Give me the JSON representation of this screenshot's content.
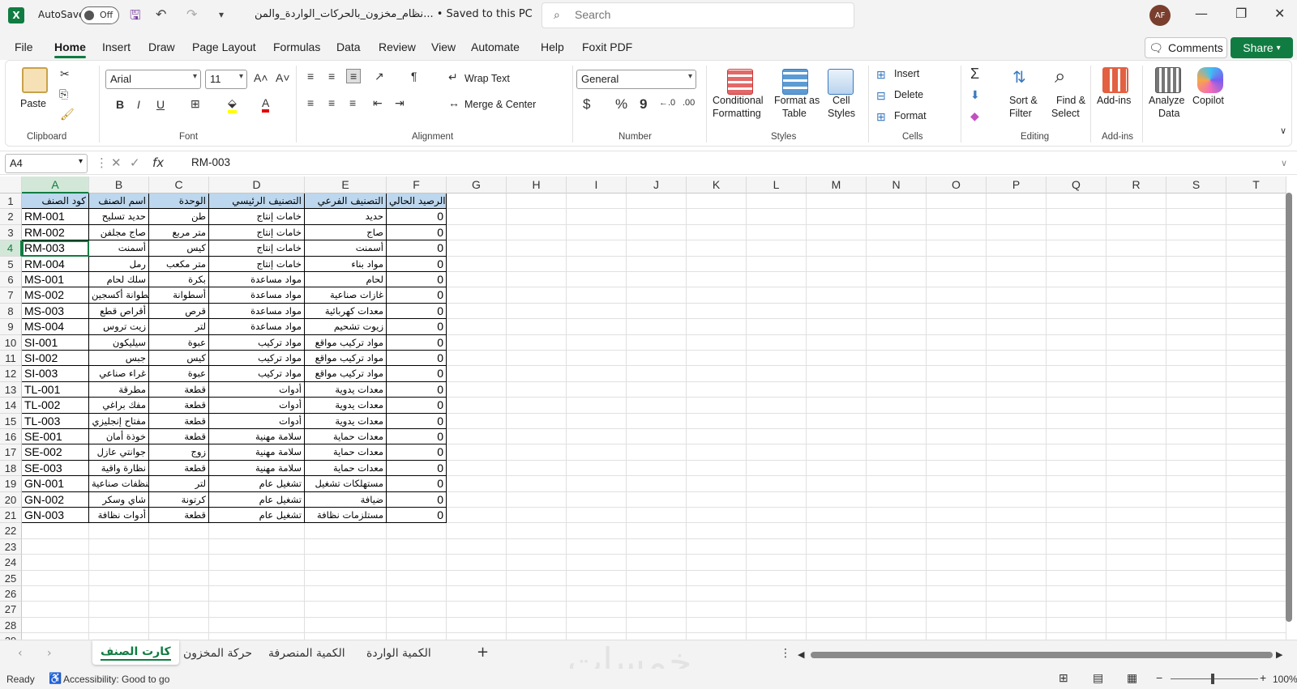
{
  "titlebar": {
    "app_logo": "X",
    "autosave_label": "AutoSave",
    "autosave_state": "Off",
    "doc_title": "نظام_مخزون_بالحركات_الواردة_والمن... • Saved to this PC",
    "search_placeholder": "Search",
    "avatar_initials": "AF"
  },
  "menu": {
    "tabs": [
      "File",
      "Home",
      "Insert",
      "Draw",
      "Page Layout",
      "Formulas",
      "Data",
      "Review",
      "View",
      "Automate",
      "Help",
      "Foxit PDF"
    ],
    "active_tab": "Home",
    "comments_label": "Comments",
    "share_label": "Share"
  },
  "ribbon": {
    "clipboard": {
      "paste": "Paste",
      "group": "Clipboard"
    },
    "font": {
      "name": "Arial",
      "size": "11",
      "group": "Font",
      "bold": "B",
      "italic": "I",
      "underline": "U",
      "grow": "A^",
      "shrink": "Aˇ"
    },
    "alignment": {
      "wrap": "Wrap Text",
      "merge": "Merge & Center",
      "group": "Alignment"
    },
    "number": {
      "format": "General",
      "currency": "$",
      "percent": "%",
      "comma": "9",
      "group": "Number"
    },
    "styles": {
      "conditional": "Conditional",
      "conditional2": "Formatting",
      "format_table": "Format as",
      "format_table2": "Table",
      "cell_styles": "Cell",
      "cell_styles2": "Styles",
      "group": "Styles"
    },
    "cells": {
      "insert": "Insert",
      "delete": "Delete",
      "format": "Format",
      "group": "Cells"
    },
    "editing": {
      "sort": "Sort &",
      "sort2": "Filter",
      "find": "Find &",
      "find2": "Select",
      "group": "Editing"
    },
    "addins": {
      "label": "Add-ins",
      "group": "Add-ins"
    },
    "analyze": {
      "label": "Analyze",
      "label2": "Data"
    },
    "copilot": {
      "label": "Copilot"
    }
  },
  "formula_bar": {
    "name_box": "A4",
    "formula": "RM-003",
    "fx": "fx"
  },
  "columns": [
    "A",
    "B",
    "C",
    "D",
    "E",
    "F",
    "G",
    "H",
    "I",
    "J",
    "K",
    "L",
    "M",
    "N",
    "O",
    "P",
    "Q",
    "R",
    "S",
    "T"
  ],
  "rows": [
    "1",
    "2",
    "3",
    "4",
    "5",
    "6",
    "7",
    "8",
    "9",
    "10",
    "11",
    "12",
    "13",
    "14",
    "15",
    "16",
    "17",
    "18",
    "19",
    "20",
    "21",
    "22",
    "23",
    "24",
    "25",
    "26",
    "27",
    "28",
    "29"
  ],
  "table": {
    "headers": [
      "كود الصنف",
      "اسم الصنف",
      "الوحدة",
      "التصنيف الرئيسي",
      "التصنيف الفرعي",
      "الرصيد الحالي"
    ],
    "rows": [
      [
        "RM-001",
        "حديد تسليح",
        "طن",
        "خامات إنتاج",
        "حديد",
        "0"
      ],
      [
        "RM-002",
        "صاج مجلفن",
        "متر مربع",
        "خامات إنتاج",
        "صاج",
        "0"
      ],
      [
        "RM-003",
        "أسمنت",
        "كيس",
        "خامات إنتاج",
        "أسمنت",
        "0"
      ],
      [
        "RM-004",
        "رمل",
        "متر مكعب",
        "خامات إنتاج",
        "مواد بناء",
        "0"
      ],
      [
        "MS-001",
        "سلك لحام",
        "بكرة",
        "مواد مساعدة",
        "لحام",
        "0"
      ],
      [
        "MS-002",
        "أسطوانة أكسجين",
        "أسطوانة",
        "مواد مساعدة",
        "غازات صناعية",
        "0"
      ],
      [
        "MS-003",
        "أقراص قطع",
        "قرص",
        "مواد مساعدة",
        "معدات كهربائية",
        "0"
      ],
      [
        "MS-004",
        "زيت تروس",
        "لتر",
        "مواد مساعدة",
        "زيوت تشحيم",
        "0"
      ],
      [
        "SI-001",
        "سيليكون",
        "عبوة",
        "مواد تركيب",
        "مواد تركيب مواقع",
        "0"
      ],
      [
        "SI-002",
        "جبس",
        "كيس",
        "مواد تركيب",
        "مواد تركيب مواقع",
        "0"
      ],
      [
        "SI-003",
        "غراء صناعي",
        "عبوة",
        "مواد تركيب",
        "مواد تركيب مواقع",
        "0"
      ],
      [
        "TL-001",
        "مطرقة",
        "قطعة",
        "أدوات",
        "معدات يدوية",
        "0"
      ],
      [
        "TL-002",
        "مفك براغي",
        "قطعة",
        "أدوات",
        "معدات يدوية",
        "0"
      ],
      [
        "TL-003",
        "مفتاح إنجليزي",
        "قطعة",
        "أدوات",
        "معدات يدوية",
        "0"
      ],
      [
        "SE-001",
        "خوذة أمان",
        "قطعة",
        "سلامة مهنية",
        "معدات حماية",
        "0"
      ],
      [
        "SE-002",
        "جوانتي عازل",
        "زوج",
        "سلامة مهنية",
        "معدات حماية",
        "0"
      ],
      [
        "SE-003",
        "نظارة واقية",
        "قطعة",
        "سلامة مهنية",
        "معدات حماية",
        "0"
      ],
      [
        "GN-001",
        "منظفات صناعية",
        "لتر",
        "تشغيل عام",
        "مستهلكات تشغيل",
        "0"
      ],
      [
        "GN-002",
        "شاي وسكر",
        "كرتونة",
        "تشغيل عام",
        "ضيافة",
        "0"
      ],
      [
        "GN-003",
        "أدوات نظافة",
        "قطعة",
        "تشغيل عام",
        "مستلزمات نظافة",
        "0"
      ]
    ]
  },
  "sheets": [
    "كارت الصنف",
    "حركة المخزون",
    "الكمية المنصرفة",
    "الكمية الواردة"
  ],
  "active_sheet": "كارت الصنف",
  "add_sheet": "+",
  "watermark": "خمسات",
  "status": {
    "ready": "Ready",
    "accessibility": "Accessibility: Good to go",
    "zoom": "100%"
  },
  "colors": {
    "accent": "#107c41",
    "header_fill": "#bdd7ee"
  }
}
